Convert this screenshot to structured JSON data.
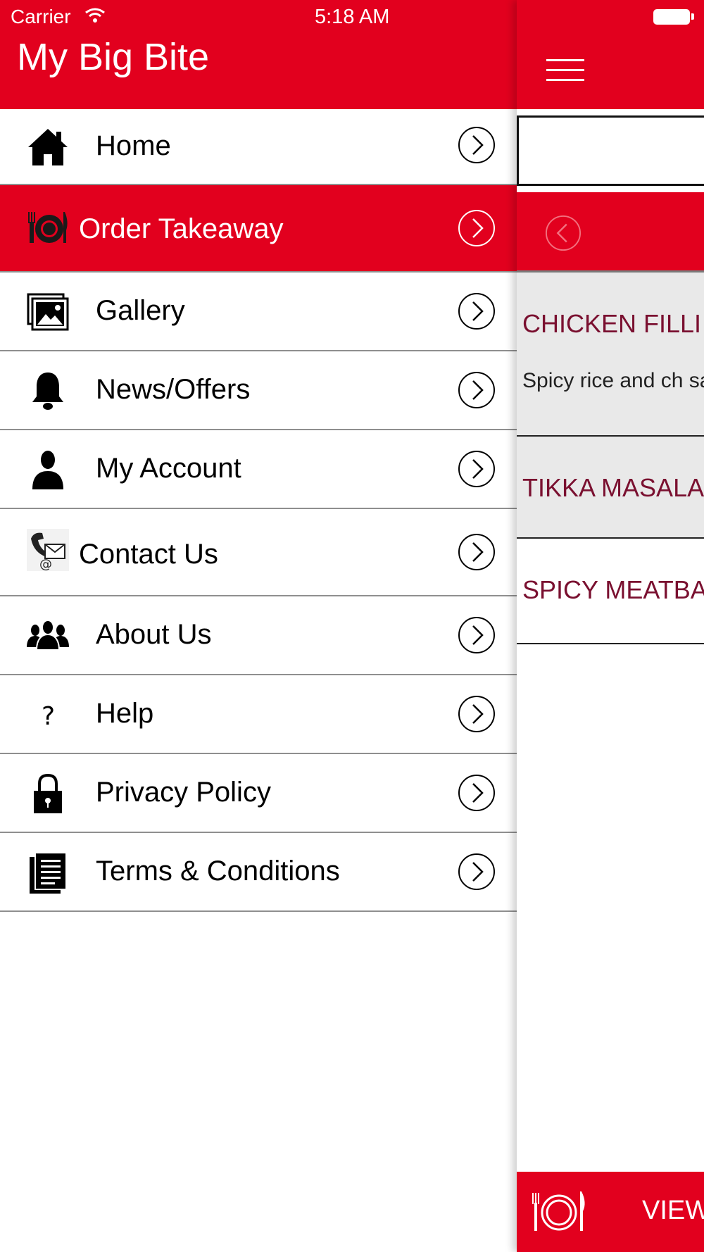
{
  "status_bar": {
    "carrier": "Carrier",
    "time": "5:18 AM"
  },
  "drawer": {
    "title": "My Big Bite",
    "items": [
      {
        "label": "Home",
        "icon": "home-icon"
      },
      {
        "label": "Order Takeaway",
        "icon": "plate-cutlery-icon",
        "active": true
      },
      {
        "label": "Gallery",
        "icon": "gallery-icon"
      },
      {
        "label": "News/Offers",
        "icon": "bell-icon"
      },
      {
        "label": "My Account",
        "icon": "user-icon"
      },
      {
        "label": "Contact Us",
        "icon": "phone-mail-icon"
      },
      {
        "label": "About Us",
        "icon": "group-icon"
      },
      {
        "label": "Help",
        "icon": "question-icon"
      },
      {
        "label": "Privacy Policy",
        "icon": "lock-icon"
      },
      {
        "label": "Terms & Conditions",
        "icon": "document-icon"
      }
    ]
  },
  "main": {
    "menu_items": [
      {
        "title": "CHICKEN FILLI",
        "description": "Spicy rice and ch salad."
      },
      {
        "title": "TIKKA MASALA",
        "description": ""
      },
      {
        "title": "SPICY MEATBA",
        "description": ""
      }
    ],
    "bottom_bar": {
      "label": "VIEW"
    }
  },
  "colors": {
    "brand_red": "#e2001e",
    "item_title": "#7a1030",
    "row_grey": "#e9e9e9"
  }
}
